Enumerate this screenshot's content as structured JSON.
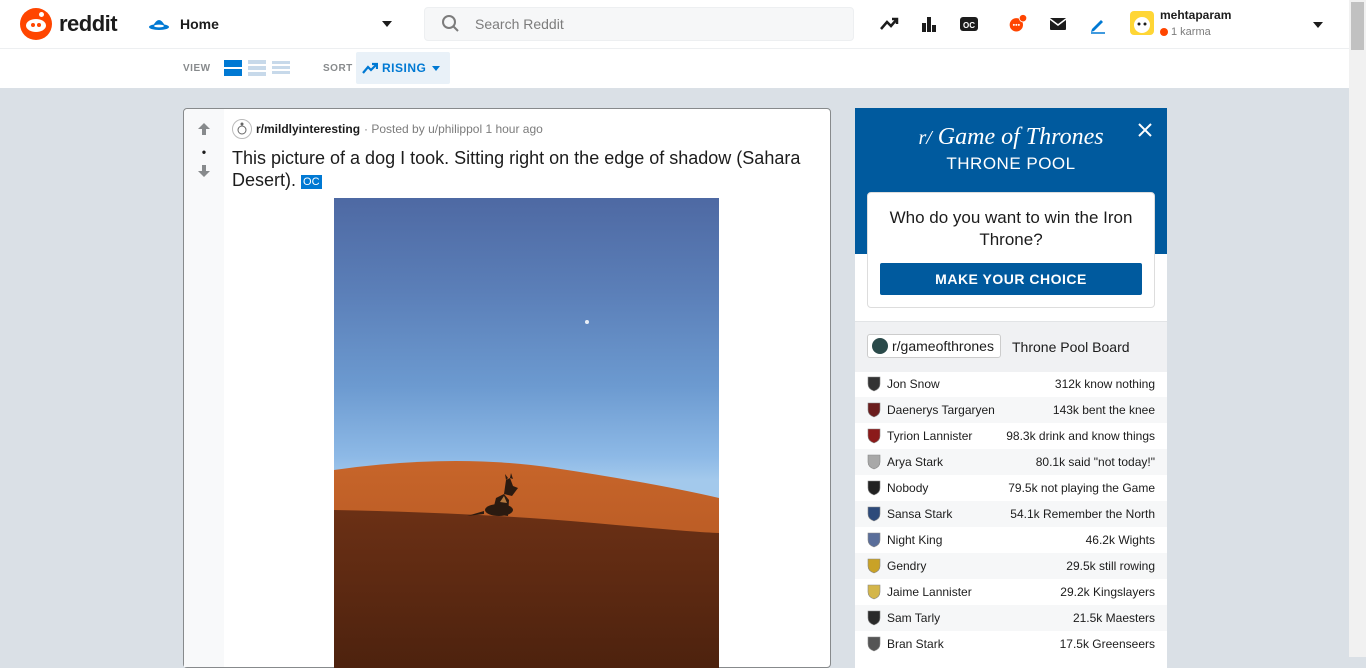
{
  "header": {
    "logo_text": "reddit",
    "home_label": "Home",
    "search_placeholder": "Search Reddit",
    "username": "mehtaparam",
    "karma": "1 karma",
    "notif_badge": "",
    "colors": {
      "brand": "#ff4500",
      "accent": "#0079d3"
    }
  },
  "subbar": {
    "view_label": "VIEW",
    "sort_label": "SORT",
    "sort_value": "RISING"
  },
  "post": {
    "vote_count": "•",
    "subreddit": "r/mildlyinteresting",
    "posted_by": "· Posted by u/philippol 1 hour ago",
    "title": "This picture of a dog I took. Sitting right on the edge of shadow (Sahara Desert).",
    "flair": "OC"
  },
  "widget": {
    "logo_prefix": "r/",
    "logo_name": "Game of Thrones",
    "subtitle": "THRONE POOL",
    "question": "Who do you want to win the Iron Throne?",
    "button": "MAKE YOUR CHOICE",
    "board_chip": "r/gameofthrones",
    "board_title": "Throne Pool Board",
    "rows": [
      {
        "name": "Jon Snow",
        "stat": "312k know nothing",
        "color": "#333333"
      },
      {
        "name": "Daenerys Targaryen",
        "stat": "143k bent the knee",
        "color": "#6b1d1d"
      },
      {
        "name": "Tyrion Lannister",
        "stat": "98.3k drink and know things",
        "color": "#8b1a1a"
      },
      {
        "name": "Arya Stark",
        "stat": "80.1k said \"not today!\"",
        "color": "#a8a8a8"
      },
      {
        "name": "Nobody",
        "stat": "79.5k not playing the Game",
        "color": "#222222"
      },
      {
        "name": "Sansa Stark",
        "stat": "54.1k Remember the North",
        "color": "#2d4a7a"
      },
      {
        "name": "Night King",
        "stat": "46.2k Wights",
        "color": "#5a6e9a"
      },
      {
        "name": "Gendry",
        "stat": "29.5k still rowing",
        "color": "#c9a227"
      },
      {
        "name": "Jaime Lannister",
        "stat": "29.2k Kingslayers",
        "color": "#d4b64a"
      },
      {
        "name": "Sam Tarly",
        "stat": "21.5k Maesters",
        "color": "#2a2a2a"
      },
      {
        "name": "Bran Stark",
        "stat": "17.5k Greenseers",
        "color": "#555555"
      }
    ]
  }
}
